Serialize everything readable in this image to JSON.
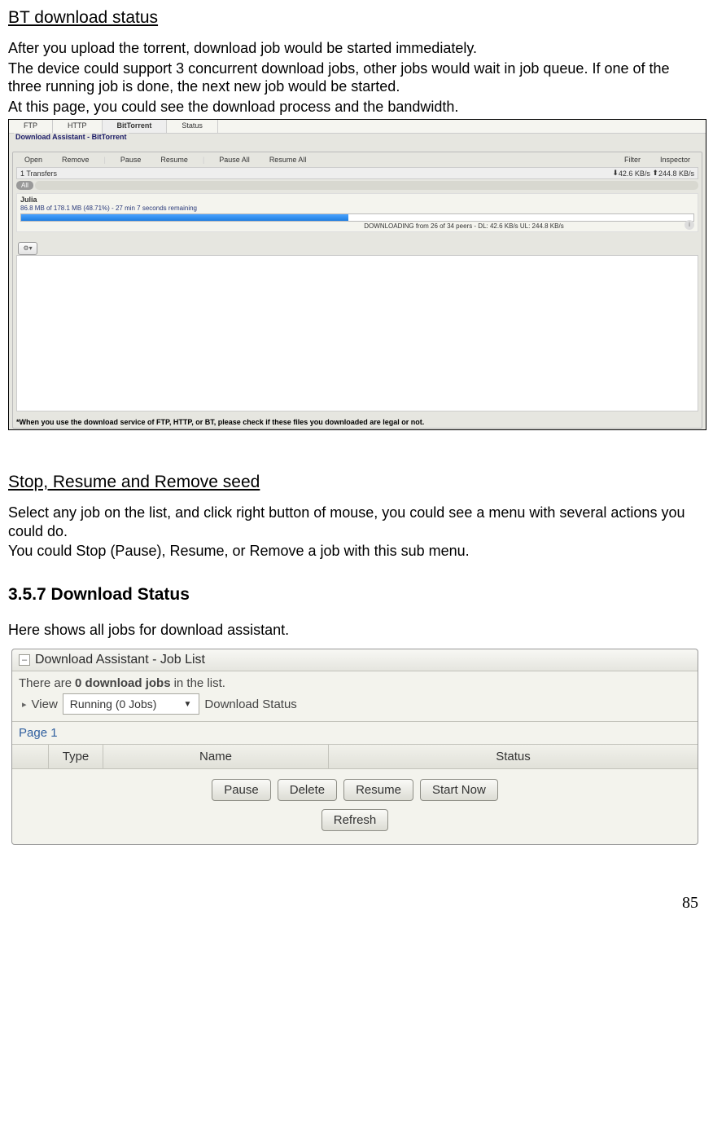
{
  "heading1": "BT download status",
  "para1": "After you upload the torrent, download job would be started immediately.",
  "para2": "The device could support 3 concurrent download jobs, other jobs would wait in job queue. If one of the three running job is done, the next new job would be started.",
  "para3": "At this page, you could see the download process and the bandwidth.",
  "heading2": "Stop, Resume and Remove seed",
  "para4": "Select any job on the list, and click right button of mouse, you could see a menu with several actions you could do.",
  "para5": "You could Stop (Pause), Resume, or Remove a job with this sub menu.",
  "heading3": "3.5.7 Download Status",
  "para6": "Here shows all jobs for download assistant.",
  "page_number": "85",
  "ss1": {
    "tabs": [
      "FTP",
      "HTTP",
      "BitTorrent",
      "Status"
    ],
    "active_tab_index": 2,
    "fieldset_label": "Download Assistant - BitTorrent",
    "toolbar": {
      "open": "Open",
      "remove": "Remove",
      "pause": "Pause",
      "resume": "Resume",
      "pause_all": "Pause All",
      "resume_all": "Resume All",
      "filter": "Filter",
      "inspector": "Inspector"
    },
    "transfers_label": "1 Transfers",
    "dl_rate": "42.6 KB/s",
    "ul_rate": "244.8 KB/s",
    "all_label": "All",
    "torrent": {
      "name": "Julia",
      "subtitle": "86.8 MB of 178.1 MB (48.71%) - 27 min 7 seconds remaining",
      "status_line": "DOWNLOADING from 26 of 34 peers - DL: 42.6 KB/s UL: 244.8 KB/s"
    },
    "gear_label": "⚙▾",
    "footnote": "*When you use the download service of FTP, HTTP, or BT, please check if these files you downloaded are legal or not."
  },
  "ss2": {
    "title": "Download Assistant - Job List",
    "count_prefix": "There are",
    "count_value": "0 download jobs",
    "count_suffix": "in the list.",
    "view_label": "View",
    "select_value": "Running (0 Jobs)",
    "status_label": "Download Status",
    "page_label": "Page 1",
    "columns": {
      "type": "Type",
      "name": "Name",
      "status": "Status"
    },
    "buttons": {
      "pause": "Pause",
      "delete": "Delete",
      "resume": "Resume",
      "start_now": "Start Now",
      "refresh": "Refresh"
    }
  }
}
